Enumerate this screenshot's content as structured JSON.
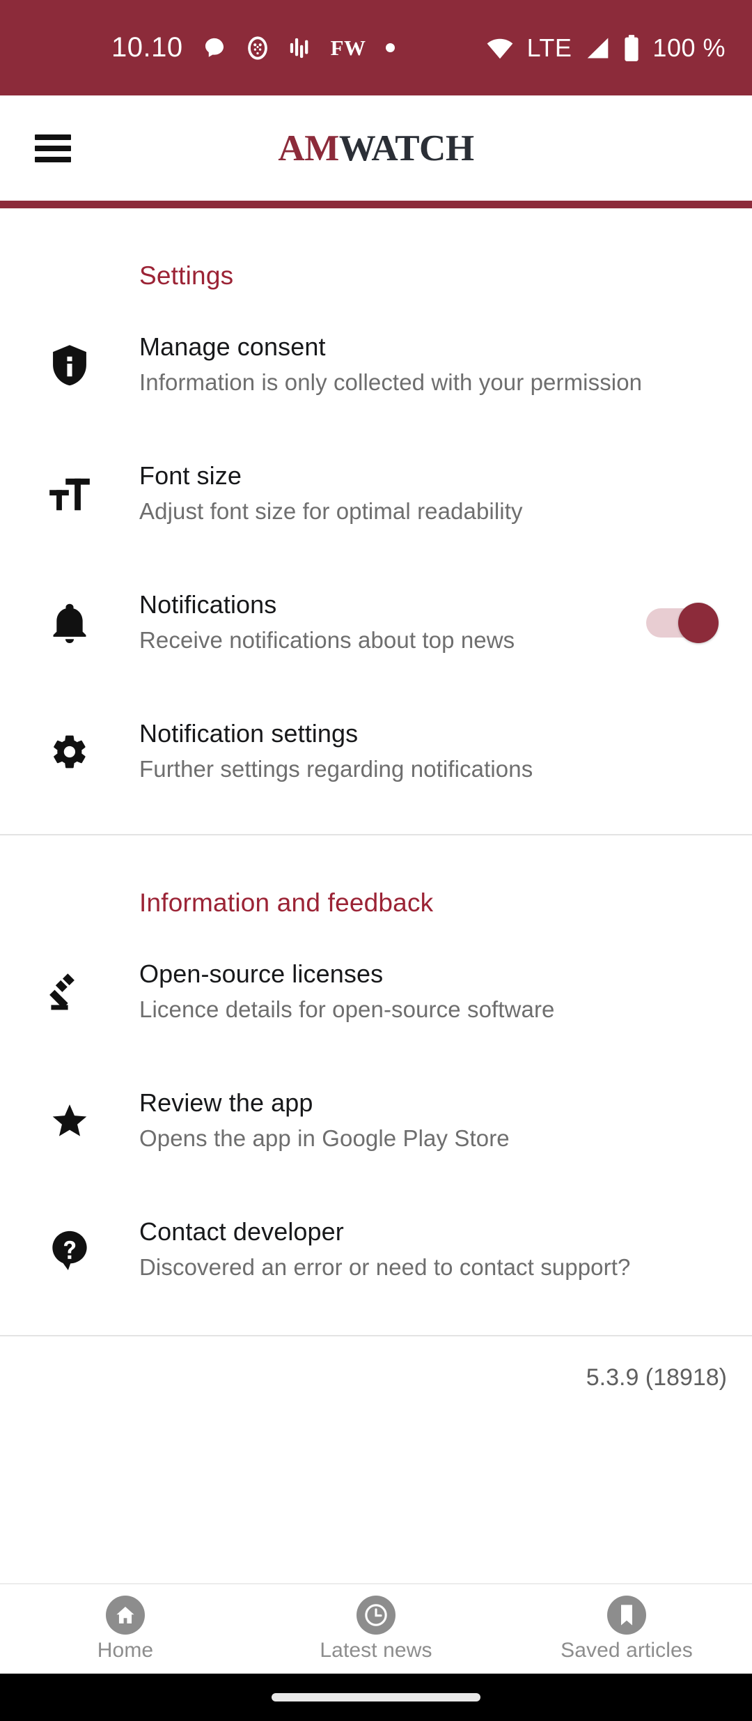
{
  "colors": {
    "brand_red": "#8C2B3A",
    "section_heading_red": "#9B2335",
    "logo_dark": "#2b2f36",
    "subtitle_gray": "#6e6e6e",
    "nav_gray": "#8d8d8d"
  },
  "statusbar": {
    "clock": "10.10",
    "icons_left": [
      "chat-bubble-icon",
      "owl-avatar-icon",
      "equalizer-icon"
    ],
    "carrier_label": "FW",
    "dot_icon": "dot-icon",
    "wifi_icon": "wifi-icon",
    "network_label": "LTE",
    "signal_icon": "signal-bars-icon",
    "battery_icon": "battery-full-icon",
    "battery_label": "100 %"
  },
  "appbar": {
    "menu_icon": "hamburger-menu-icon",
    "logo_part1": "AM",
    "logo_part2": "WATCH"
  },
  "sections": [
    {
      "heading": "Settings",
      "rows": [
        {
          "icon": "privacy-shield-icon",
          "title": "Manage consent",
          "subtitle": "Information is only collected with your permission",
          "has_toggle": false
        },
        {
          "icon": "font-size-icon",
          "title": "Font size",
          "subtitle": "Adjust font size for optimal readability",
          "has_toggle": false
        },
        {
          "icon": "bell-icon",
          "title": "Notifications",
          "subtitle": "Receive notifications about top news",
          "has_toggle": true,
          "toggle_state": "on"
        },
        {
          "icon": "gear-icon",
          "title": "Notification settings",
          "subtitle": "Further settings regarding notifications",
          "has_toggle": false
        }
      ]
    },
    {
      "heading": "Information and feedback",
      "rows": [
        {
          "icon": "gavel-icon",
          "title": "Open-source licenses",
          "subtitle": "Licence details for open-source software",
          "has_toggle": false
        },
        {
          "icon": "star-icon",
          "title": "Review the app",
          "subtitle": "Opens the app in Google Play Store",
          "has_toggle": false
        },
        {
          "icon": "help-question-icon",
          "title": "Contact developer",
          "subtitle": "Discovered an error or need to contact support?",
          "has_toggle": false
        }
      ]
    }
  ],
  "version": "5.3.9 (18918)",
  "bottomnav": {
    "items": [
      {
        "icon": "home-icon",
        "label": "Home"
      },
      {
        "icon": "clock-icon",
        "label": "Latest news"
      },
      {
        "icon": "bookmark-icon",
        "label": "Saved articles"
      }
    ]
  }
}
